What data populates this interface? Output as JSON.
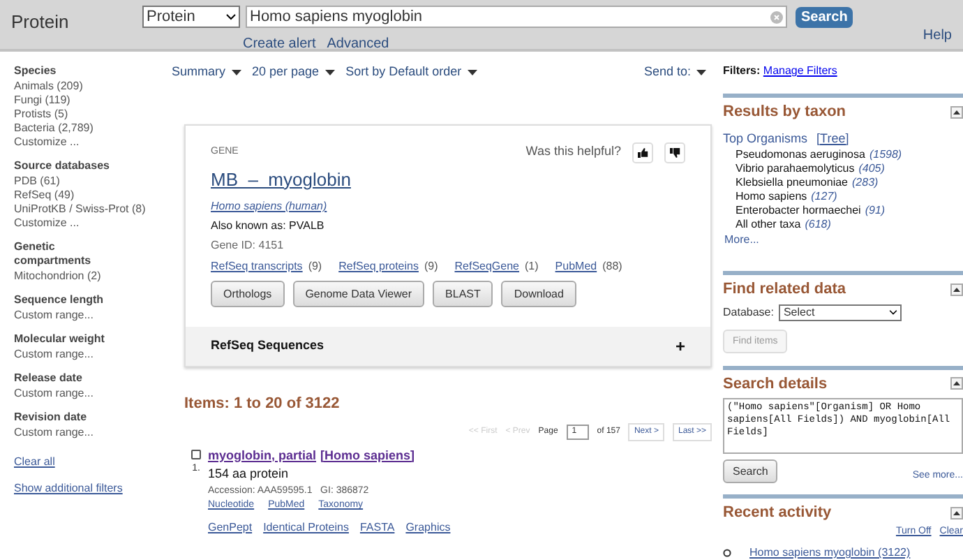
{
  "header": {
    "title": "Protein",
    "database": "Protein",
    "query": "Homo sapiens myoglobin",
    "search_button": "Search",
    "links": [
      "Create alert",
      "Advanced"
    ],
    "help": "Help"
  },
  "sidebar": {
    "groups": [
      {
        "title": "Species",
        "items": [
          "Animals (209)",
          "Fungi (119)",
          "Protists (5)",
          "Bacteria (2,789)",
          "Customize ..."
        ]
      },
      {
        "title": "Source databases",
        "items": [
          "PDB (61)",
          "RefSeq (49)",
          "UniProtKB / Swiss-Prot (8)",
          "Customize ..."
        ]
      },
      {
        "title": "Genetic compartments",
        "items": [
          "Mitochondrion (2)"
        ]
      },
      {
        "title": "Sequence length",
        "items": [
          "Custom range..."
        ]
      },
      {
        "title": "Molecular weight",
        "items": [
          "Custom range..."
        ]
      },
      {
        "title": "Release date",
        "items": [
          "Custom range..."
        ]
      },
      {
        "title": "Revision date",
        "items": [
          "Custom range..."
        ]
      }
    ],
    "links": [
      "Clear all",
      "Show additional filters"
    ]
  },
  "toolbar": {
    "menus": [
      "Summary",
      "20 per page",
      "Sort by Default order"
    ],
    "send_to": "Send to:"
  },
  "gene_card": {
    "label": "GENE",
    "helpful": "Was this helpful?",
    "title": "MB  –  myoglobin",
    "organism": "Homo sapiens (human)",
    "aka": "Also known as: PVALB",
    "gene_id": "Gene ID: 4151",
    "links": [
      {
        "link": "RefSeq transcripts",
        "count": "(9)"
      },
      {
        "link": "RefSeq proteins",
        "count": "(9)"
      },
      {
        "link": "RefSeqGene",
        "count": "(1)"
      },
      {
        "link": "PubMed",
        "count": "(88)"
      }
    ],
    "buttons": [
      "Orthologs",
      "Genome Data Viewer",
      "BLAST",
      "Download"
    ],
    "section": "RefSeq Sequences",
    "section_toggle": "+"
  },
  "results": {
    "heading": "Items: 1 to 20 of 3122",
    "pager": {
      "first": "<< First",
      "prev": "< Prev",
      "page_label": "Page",
      "page": "1",
      "of": "of 157",
      "next": "Next >",
      "last": "Last >>"
    },
    "items": [
      {
        "number": "1.",
        "checked": false,
        "title": "myoglobin, partial",
        "organism": "[Homo sapiens]",
        "desc": "154 aa protein",
        "accession": "Accession: AAA59595.1   GI: 386872",
        "links1": [
          "Nucleotide",
          "PubMed",
          "Taxonomy"
        ],
        "links2": [
          "GenPept",
          "Identical Proteins",
          "FASTA",
          "Graphics"
        ]
      }
    ]
  },
  "right": {
    "filters_label": "Filters:",
    "manage": "Manage Filters",
    "taxon": {
      "title": "Results by taxon",
      "top": "Top Organisms",
      "tree": "[Tree]",
      "organisms": [
        {
          "name": "Pseudomonas aeruginosa",
          "count": "(1598)"
        },
        {
          "name": "Vibrio parahaemolyticus",
          "count": "(405)"
        },
        {
          "name": "Klebsiella pneumoniae",
          "count": "(283)"
        },
        {
          "name": "Homo sapiens",
          "count": "(127)"
        },
        {
          "name": "Enterobacter hormaechei",
          "count": "(91)"
        },
        {
          "name": "All other taxa",
          "count": "(618)"
        }
      ],
      "more": "More..."
    },
    "related": {
      "title": "Find related data",
      "db_label": "Database:",
      "db_value": "Select",
      "button": "Find items",
      "button_disabled": true
    },
    "details": {
      "title": "Search details",
      "query": "(\"Homo sapiens\"[Organism] OR Homo sapiens[All Fields]) AND myoglobin[All Fields]",
      "button": "Search",
      "see_more": "See more..."
    },
    "recent": {
      "title": "Recent activity",
      "links": [
        "Turn Off",
        "Clear"
      ],
      "items": [
        "Homo sapiens myoglobin (3122)"
      ]
    }
  }
}
